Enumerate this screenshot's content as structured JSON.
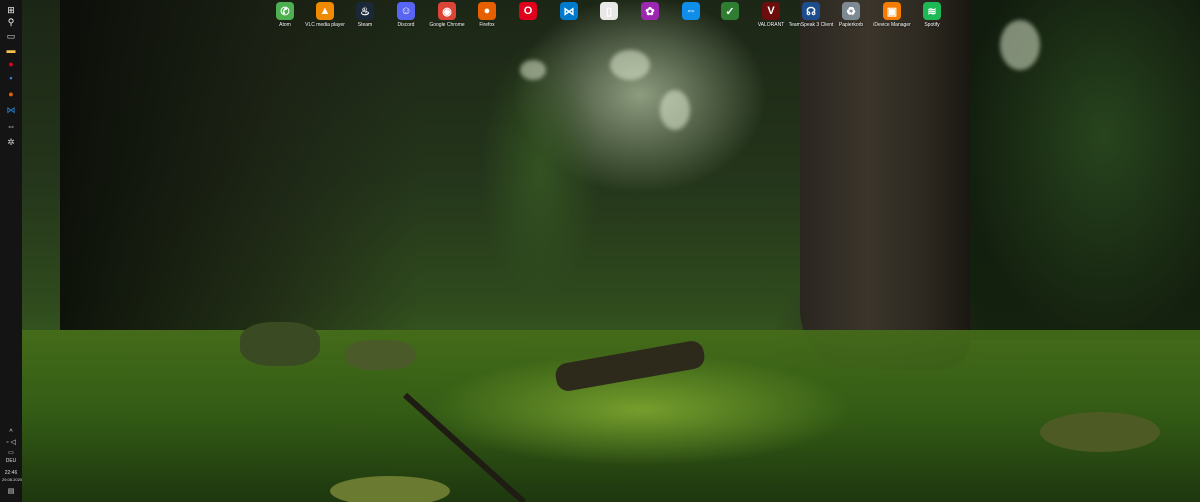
{
  "desktop": {
    "icons": [
      {
        "label": "Atom",
        "icon": "atom-icon",
        "color": "#4caf50",
        "glyph": "✆"
      },
      {
        "label": "VLC media player",
        "icon": "vlc-icon",
        "color": "#f08a00",
        "glyph": "▲"
      },
      {
        "label": "Steam",
        "icon": "steam-icon",
        "color": "#1b2838",
        "glyph": "♨"
      },
      {
        "label": "Discord",
        "icon": "discord-icon",
        "color": "#5865f2",
        "glyph": "☺"
      },
      {
        "label": "Google Chrome",
        "icon": "chrome-icon",
        "color": "#db4437",
        "glyph": "◉"
      },
      {
        "label": "Firefox",
        "icon": "firefox-icon",
        "color": "#e66000",
        "glyph": "●"
      },
      {
        "label": "",
        "icon": "opera-icon",
        "color": "#e0001b",
        "glyph": "O"
      },
      {
        "label": "",
        "icon": "visual-studio-code-icon",
        "color": "#007acc",
        "glyph": "⋈"
      },
      {
        "label": "",
        "icon": "file-icon",
        "color": "#e8e8e8",
        "glyph": "▯"
      },
      {
        "label": "",
        "icon": "colorful-app-icon",
        "color": "#9c27b0",
        "glyph": "✿"
      },
      {
        "label": "",
        "icon": "teamviewer-icon",
        "color": "#0e8ee9",
        "glyph": "⇔"
      },
      {
        "label": "",
        "icon": "app-icon",
        "color": "#2e7d32",
        "glyph": "✓"
      },
      {
        "label": "VALORANT",
        "icon": "valorant-icon",
        "color": "#6b0d0d",
        "glyph": "V"
      },
      {
        "label": "TeamSpeak 3 Client",
        "icon": "teamspeak-icon",
        "color": "#1d4d8c",
        "glyph": "☊"
      },
      {
        "label": "Papierkorb",
        "icon": "recycle-bin-icon",
        "color": "#7d8a94",
        "glyph": "♻"
      },
      {
        "label": "iDevice Manager",
        "icon": "idevice-manager-icon",
        "color": "#f57c00",
        "glyph": "▣"
      },
      {
        "label": "Spotify",
        "icon": "spotify-icon",
        "color": "#1db954",
        "glyph": "≋"
      }
    ]
  },
  "taskbar": {
    "icons": [
      {
        "name": "start-icon",
        "glyph": "⊞",
        "color": "#ffffff"
      },
      {
        "name": "search-icon",
        "glyph": "⚲",
        "color": "#ffffff"
      },
      {
        "name": "task-view-icon",
        "glyph": "▭",
        "color": "#dddddd"
      },
      {
        "name": "file-explorer-icon",
        "glyph": "▬",
        "color": "#f2c14e"
      },
      {
        "name": "opera-taskbar-icon",
        "glyph": "●",
        "color": "#e0001b"
      },
      {
        "name": "app-taskbar-icon",
        "glyph": "▪",
        "color": "#3d7dd8"
      },
      {
        "name": "firefox-taskbar-icon",
        "glyph": "●",
        "color": "#e66000"
      },
      {
        "name": "vscode-taskbar-icon",
        "glyph": "⋈",
        "color": "#2b8ee0"
      },
      {
        "name": "teamviewer-taskbar-icon",
        "glyph": "⇔",
        "color": "#cccccc"
      },
      {
        "name": "settings-taskbar-icon",
        "glyph": "✲",
        "color": "#cccccc"
      }
    ],
    "tray": {
      "language": "DEU",
      "time": "22:46",
      "date": "29.08.2020"
    }
  }
}
